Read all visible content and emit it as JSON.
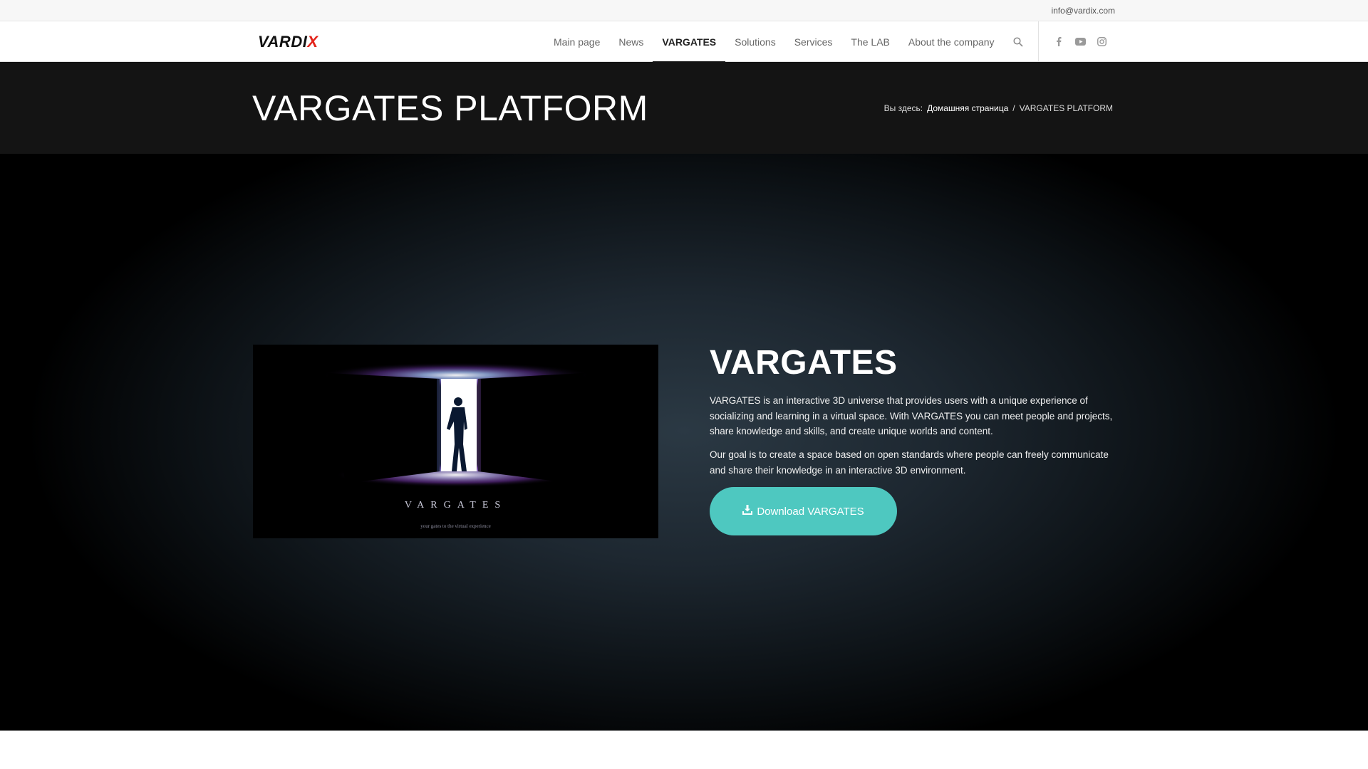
{
  "topbar": {
    "email": "info@vardix.com"
  },
  "header": {
    "logo": {
      "main": "VARDI",
      "accent": "X"
    },
    "nav": [
      {
        "label": "Main page",
        "active": false
      },
      {
        "label": "News",
        "active": false
      },
      {
        "label": "VARGATES",
        "active": true
      },
      {
        "label": "Solutions",
        "active": false
      },
      {
        "label": "Services",
        "active": false
      },
      {
        "label": "The LAB",
        "active": false
      },
      {
        "label": "About the company",
        "active": false
      }
    ],
    "search_icon": "search-icon",
    "socials": [
      "facebook-icon",
      "youtube-icon",
      "instagram-icon"
    ]
  },
  "titlebar": {
    "title": "VARGATES PLATFORM",
    "breadcrumb": {
      "prefix": "Вы здесь:",
      "home": "Домашняя страница",
      "separator": "/",
      "current": "VARGATES PLATFORM"
    }
  },
  "hero": {
    "promo": {
      "title": "VARGATES",
      "subtitle": "your gates to the virtual experience"
    },
    "heading": "VARGATES",
    "paragraph1": "VARGATES is an interactive 3D universe that provides users with a unique experience of socializing and learning in a virtual space. With VARGATES you can meet people and projects, share knowledge and skills, and create unique worlds and content.",
    "paragraph2": "Our goal is to create a space based on open standards where people can freely communicate and share their knowledge in an interactive 3D environment.",
    "button_label": "Download VARGATES",
    "button_icon": "download-icon"
  },
  "colors": {
    "accent": "#4ec8c0",
    "logo_x": "#e3241b",
    "titlebar_bg": "#141414"
  }
}
